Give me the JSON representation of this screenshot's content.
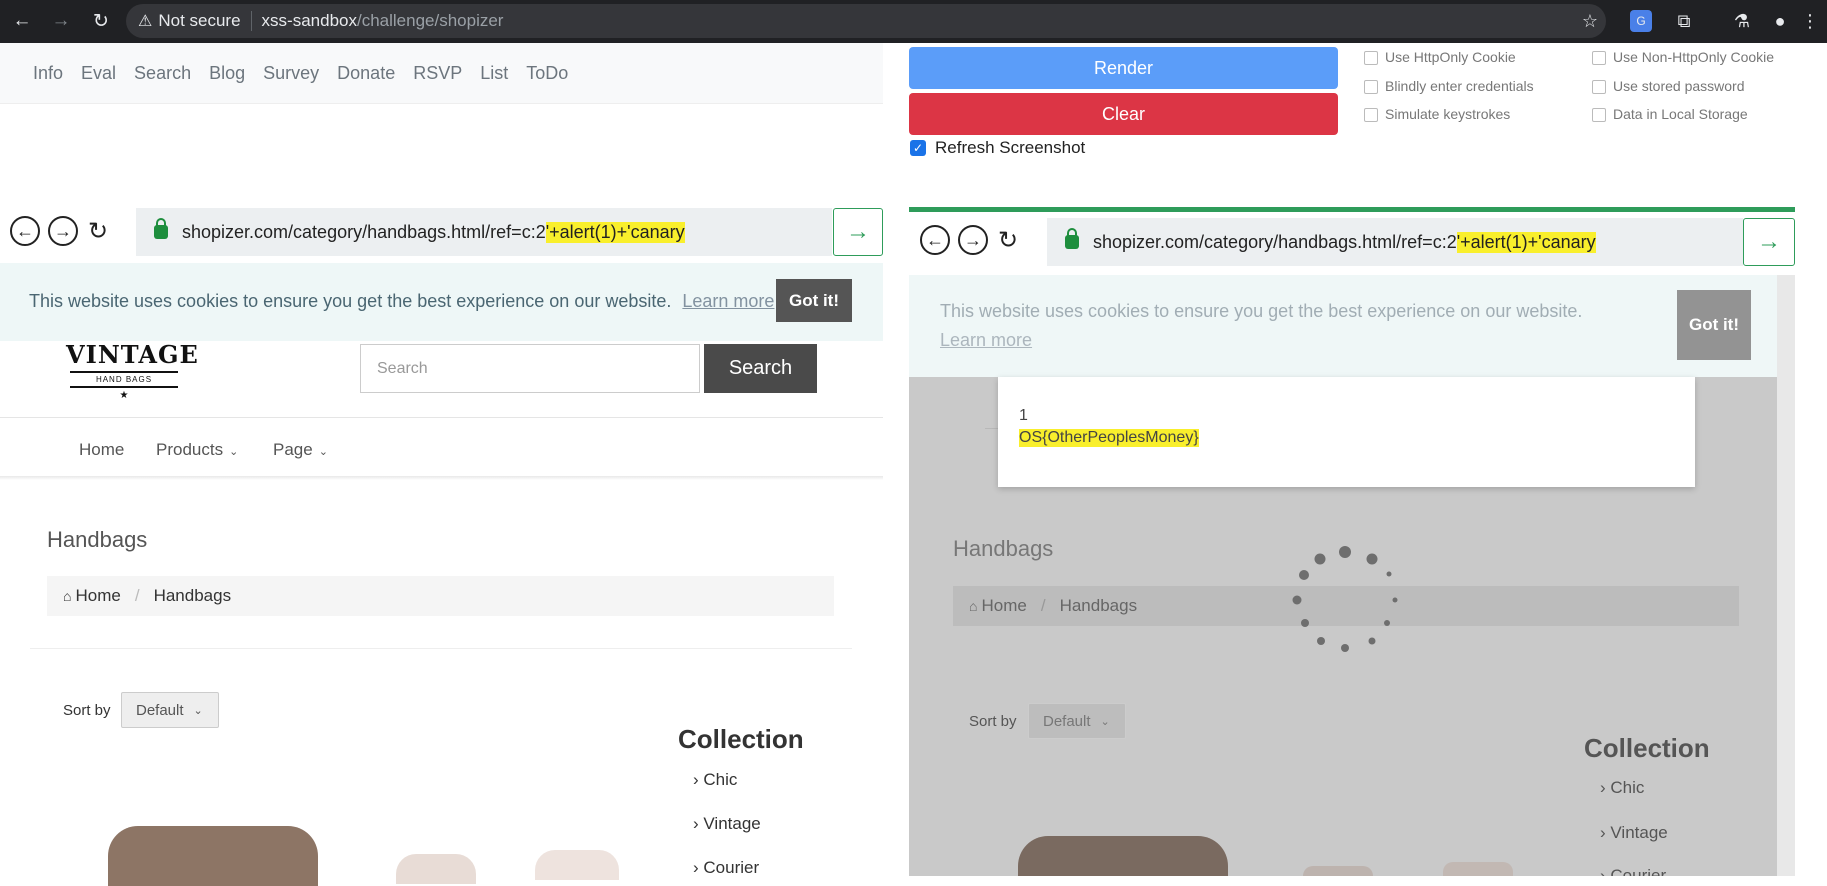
{
  "browser": {
    "not_secure": "Not secure",
    "host": "xss-sandbox",
    "path": "/challenge/shopizer"
  },
  "nav": [
    "Info",
    "Eval",
    "Search",
    "Blog",
    "Survey",
    "Donate",
    "RSVP",
    "List",
    "ToDo"
  ],
  "controls": {
    "render_label": "Render",
    "clear_label": "Clear",
    "refresh_label": "Refresh Screenshot",
    "refresh_checked": true,
    "options": [
      {
        "label": "Use HttpOnly Cookie",
        "checked": false
      },
      {
        "label": "Use Non-HttpOnly Cookie",
        "checked": false
      },
      {
        "label": "Blindly enter credentials",
        "checked": false
      },
      {
        "label": "Use stored password",
        "checked": false
      },
      {
        "label": "Simulate keystrokes",
        "checked": false
      },
      {
        "label": "Data in Local Storage",
        "checked": false
      }
    ]
  },
  "left_frame": {
    "url_plain": "shopizer.com/category/handbags.html/ref=c:2",
    "url_payload": "'+alert(1)+'canary",
    "cookie_text": "This website uses cookies to ensure you get the best experience on our website.",
    "cookie_learn": "Learn more",
    "cookie_button": "Got it!",
    "logo_text": "VINTAGE",
    "logo_sub": "HAND BAGS",
    "search_placeholder": "Search",
    "search_button": "Search",
    "menu": [
      "Home",
      "Products",
      "Page"
    ],
    "page_title": "Handbags",
    "breadcrumb": [
      "Home",
      "Handbags"
    ],
    "sort_label": "Sort by",
    "sort_value": "Default",
    "collection_title": "Collection",
    "collection_items": [
      "Chic",
      "Vintage",
      "Courier"
    ]
  },
  "right_frame": {
    "url_plain": "shopizer.com/category/handbags.html/ref=c:2",
    "url_payload": "'+alert(1)+'canary",
    "cookie_text": "This website uses cookies to ensure you get the best experience on our website.",
    "cookie_learn": "Learn more",
    "cookie_button": "Got it!",
    "alert_line1": "1",
    "alert_line2": "OS{OtherPeoplesMoney}",
    "page_title": "Handbags",
    "breadcrumb": [
      "Home",
      "Handbags"
    ],
    "sort_label": "Sort by",
    "sort_value": "Default",
    "collection_title": "Collection",
    "collection_items": [
      "Chic",
      "Vintage",
      "Courier"
    ]
  },
  "colors": {
    "render": "#5b9df9",
    "clear": "#dc3545",
    "progress": "#2e9c5a",
    "highlight": "#f9ef2c"
  }
}
